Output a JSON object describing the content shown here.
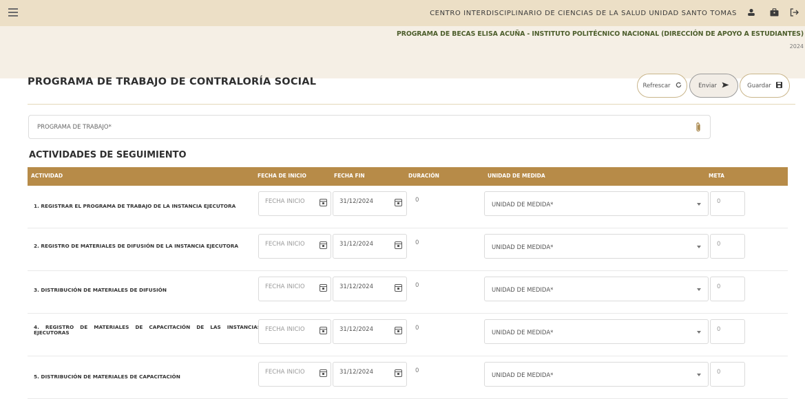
{
  "header": {
    "center_name": "CENTRO INTERDISCIPLINARIO DE CIENCIAS DE LA SALUD UNIDAD SANTO TOMAS",
    "program_name": "PROGRAMA DE BECAS ELISA ACUÑA - INSTITUTO POLITÉCNICO NACIONAL (DIRECCIÓN DE APOYO A ESTUDIANTES)",
    "year": "2024",
    "icons": [
      "menu-icon",
      "user-icon",
      "briefcase-icon",
      "logout-icon"
    ]
  },
  "page": {
    "title": "PROGRAMA DE TRABAJO DE CONTRALORÍA SOCIAL",
    "buttons": {
      "refresh": "Refrescar",
      "send": "Enviar",
      "save": "Guardar"
    }
  },
  "program_input": {
    "label": "PROGRAMA DE TRABAJO*"
  },
  "activities": {
    "section_title": "ACTIVIDADES DE SEGUIMIENTO",
    "columns": [
      "ACTIVIDAD",
      "FECHA DE INICIO",
      "FECHA FIN",
      "DURACIÓN",
      "UNIDAD DE MEDIDA",
      "META"
    ],
    "rows": [
      {
        "activity": "1. REGISTRAR EL PROGRAMA DE TRABAJO DE LA INSTANCIA EJECUTORA",
        "start_placeholder": "FECHA INICIO",
        "end_date": "31/12/2024",
        "duration": "0",
        "unit": "UNIDAD DE MEDIDA*",
        "meta": "0"
      },
      {
        "activity": "2. REGISTRO DE MATERIALES DE DIFUSIÓN DE LA INSTANCIA EJECUTORA",
        "start_placeholder": "FECHA INICIO",
        "end_date": "31/12/2024",
        "duration": "0",
        "unit": "UNIDAD DE MEDIDA*",
        "meta": "0"
      },
      {
        "activity": "3. DISTRIBUCIÓN DE MATERIALES DE DIFUSIÓN",
        "start_placeholder": "FECHA INICIO",
        "end_date": "31/12/2024",
        "duration": "0",
        "unit": "UNIDAD DE MEDIDA*",
        "meta": "0"
      },
      {
        "activity": "4. REGISTRO DE MATERIALES DE CAPACITACIÓN DE LAS INSTANCIAS EJECUTORAS",
        "start_placeholder": "FECHA INICIO",
        "end_date": "31/12/2024",
        "duration": "0",
        "unit": "UNIDAD DE MEDIDA*",
        "meta": "0"
      },
      {
        "activity": "5. DISTRIBUCIÓN DE MATERIALES DE CAPACITACIÓN",
        "start_placeholder": "FECHA INICIO",
        "end_date": "31/12/2024",
        "duration": "0",
        "unit": "UNIDAD DE MEDIDA*",
        "meta": "0"
      }
    ]
  },
  "colors": {
    "topbar": "#ecdfc6",
    "subheader": "#f5efe5",
    "table_header": "#b78b48",
    "program_text": "#4d5e2c"
  }
}
